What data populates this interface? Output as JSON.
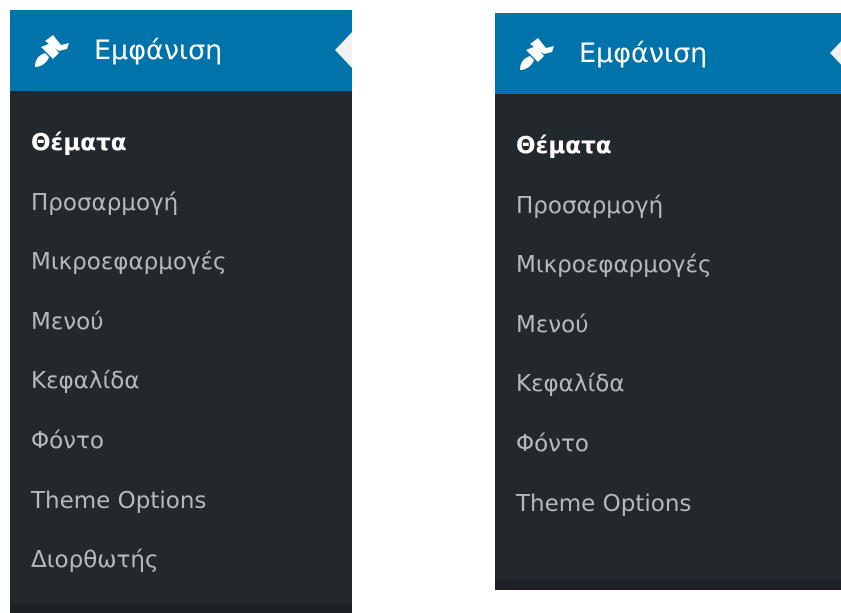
{
  "colors": {
    "sidebar_bg": "#23282d",
    "header_bg": "#0073aa",
    "active_text": "#ffffff",
    "inactive_text": "#b4b9be"
  },
  "left_panel": {
    "header": {
      "icon": "paintbrush-icon",
      "title": "Εμφάνιση"
    },
    "items": [
      {
        "label": "Θέματα",
        "active": true
      },
      {
        "label": "Προσαρμογή",
        "active": false
      },
      {
        "label": "Μικροεφαρμογές",
        "active": false
      },
      {
        "label": "Μενού",
        "active": false
      },
      {
        "label": "Κεφαλίδα",
        "active": false
      },
      {
        "label": "Φόντο",
        "active": false
      },
      {
        "label": "Theme Options",
        "active": false
      },
      {
        "label": "Διορθωτής",
        "active": false
      }
    ]
  },
  "right_panel": {
    "header": {
      "icon": "paintbrush-icon",
      "title": "Εμφάνιση"
    },
    "items": [
      {
        "label": "Θέματα",
        "active": true
      },
      {
        "label": "Προσαρμογή",
        "active": false
      },
      {
        "label": "Μικροεφαρμογές",
        "active": false
      },
      {
        "label": "Μενού",
        "active": false
      },
      {
        "label": "Κεφαλίδα",
        "active": false
      },
      {
        "label": "Φόντο",
        "active": false
      },
      {
        "label": "Theme Options",
        "active": false
      }
    ]
  }
}
